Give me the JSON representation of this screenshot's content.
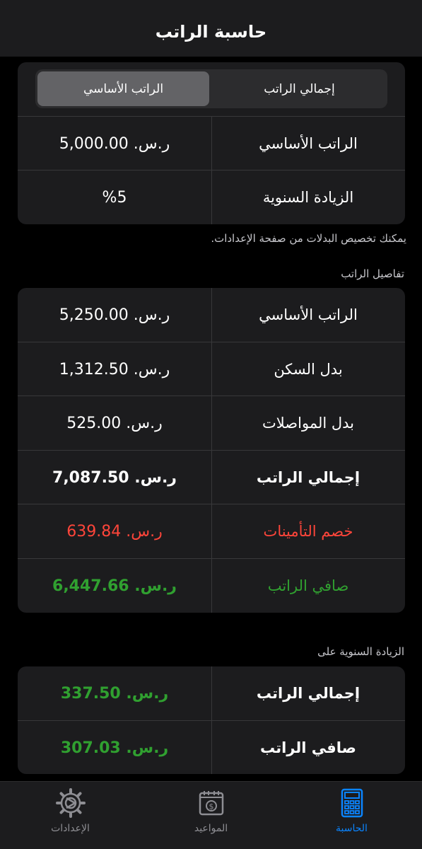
{
  "nav": {
    "title": "حاسبة الراتب"
  },
  "segmented": {
    "left_label": "الراتب الأساسي",
    "right_label": "إجمالي الراتب",
    "selected": "left"
  },
  "inputs": {
    "rows": [
      {
        "label": "الراتب الأساسي",
        "value": "ر.س. 5,000.00"
      },
      {
        "label": "الزيادة السنوية",
        "value": "%5"
      }
    ]
  },
  "footnote": "يمكنك تخصيص البدلات من صفحة الإعدادات.",
  "details": {
    "header": "تفاصيل الراتب",
    "rows": [
      {
        "label": "الراتب الأساسي",
        "value": "ر.س. 5,250.00"
      },
      {
        "label": "بدل السكن",
        "value": "ر.س. 1,312.50"
      },
      {
        "label": "بدل المواصلات",
        "value": "ر.س. 525.00"
      },
      {
        "label": "إجمالي الراتب",
        "value": "ر.س. 7,087.50"
      },
      {
        "label": "خصم التأمينات",
        "value": "ر.س. 639.84"
      },
      {
        "label": "صافي الراتب",
        "value": "ر.س. 6,447.66"
      }
    ]
  },
  "increase": {
    "header": "الزيادة السنوية على",
    "rows": [
      {
        "label": "إجمالي الراتب",
        "value": "ر.س. 337.50"
      },
      {
        "label": "صافي الراتب",
        "value": "ر.س. 307.03"
      }
    ]
  },
  "tabs": [
    {
      "label": "الإعدادات",
      "icon": "gear-icon"
    },
    {
      "label": "المواعيد",
      "icon": "calendar-dollar-icon"
    },
    {
      "label": "الحاسبة",
      "icon": "calculator-icon",
      "active": true
    }
  ],
  "colors": {
    "accent": "#0a84ff",
    "negative": "#ff453a",
    "positive": "#30a030"
  }
}
